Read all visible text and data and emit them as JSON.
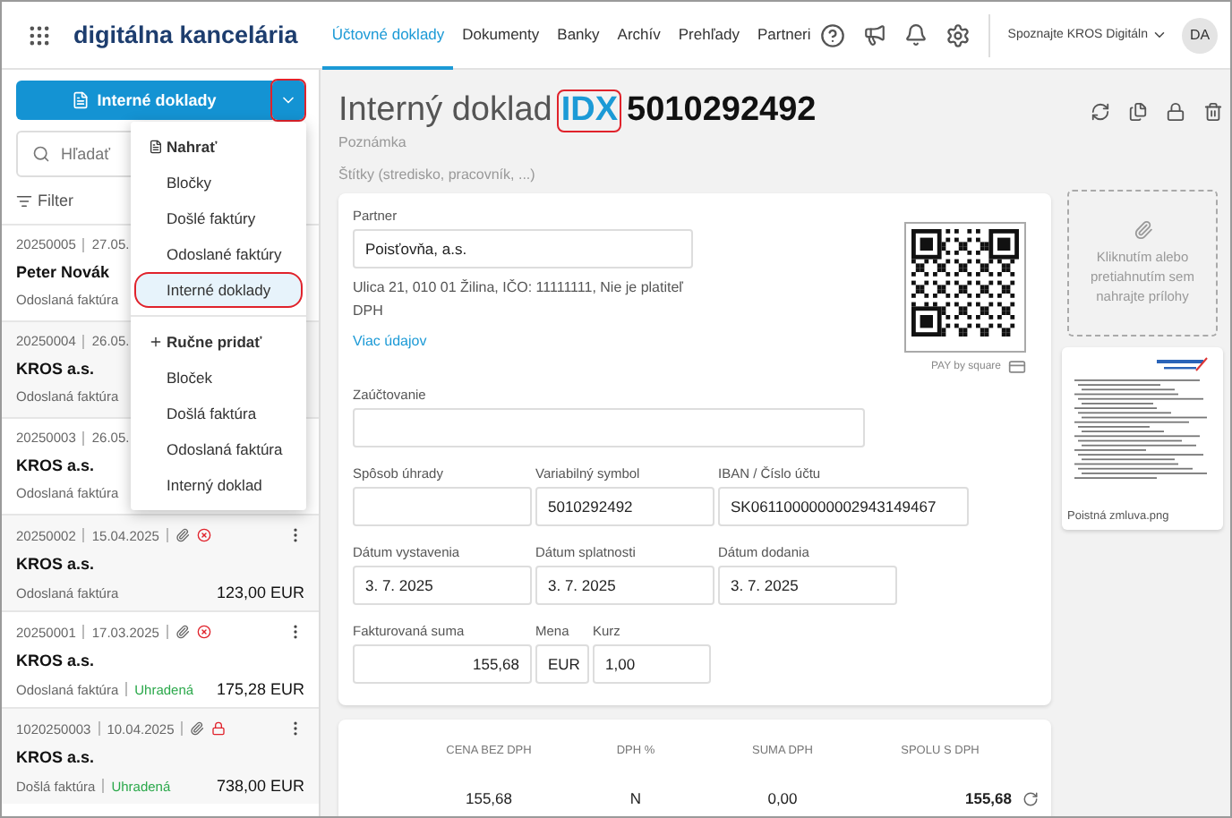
{
  "app": {
    "logo": "digitálna kancelária",
    "promo": "Spoznajte KROS Digitáln",
    "avatar": "DA"
  },
  "nav_tabs": [
    {
      "label": "Účtovné doklady",
      "selected": true
    },
    {
      "label": "Dokumenty",
      "selected": false
    },
    {
      "label": "Banky",
      "selected": false
    },
    {
      "label": "Archív",
      "selected": false
    },
    {
      "label": "Prehľady",
      "selected": false
    },
    {
      "label": "Partneri",
      "selected": false
    }
  ],
  "sidebar": {
    "create_button": {
      "label": "Interné doklady",
      "toggle_highlighted": true
    },
    "search": {
      "placeholder": "Hľadať"
    },
    "filter": {
      "label": "Filter"
    },
    "documents": [
      {
        "number": "20250005",
        "date": "27.05.",
        "partner": "Peter Novák",
        "type": "Odoslaná faktúra"
      },
      {
        "number": "20250004",
        "date": "26.05.",
        "partner": "KROS a.s.",
        "type": "Odoslaná faktúra"
      },
      {
        "number": "20250003",
        "date": "26.05.",
        "partner": "KROS a.s.",
        "type": "Odoslaná faktúra"
      },
      {
        "number": "20250002",
        "date": "15.04.2025",
        "attachment": true,
        "cancelled": true,
        "locked": false,
        "partner": "KROS a.s.",
        "type": "Odoslaná faktúra",
        "amount": "123,00 EUR"
      },
      {
        "number": "20250001",
        "date": "17.03.2025",
        "attachment": true,
        "cancelled": true,
        "locked": false,
        "partner": "KROS a.s.",
        "type": "Odoslaná faktúra",
        "payment_status": "Uhradená",
        "amount": "175,28 EUR"
      },
      {
        "number": "1020250003",
        "date": "10.04.2025",
        "attachment": true,
        "cancelled": false,
        "locked": true,
        "partner": "KROS a.s.",
        "type": "Došlá faktúra",
        "payment_status": "Uhradená",
        "amount": "738,00 EUR"
      }
    ]
  },
  "dropdown": {
    "expanded": true,
    "sections": [
      {
        "kind": "upload",
        "heading": "Nahrať",
        "items": [
          {
            "label": "Bločky",
            "selected": false,
            "highlighted": false
          },
          {
            "label": "Došlé faktúry",
            "selected": false,
            "highlighted": false
          },
          {
            "label": "Odoslané faktúry",
            "selected": false,
            "highlighted": false
          },
          {
            "label": "Interné doklady",
            "selected": true,
            "highlighted": true
          }
        ]
      },
      {
        "kind": "manual",
        "heading": "Ručne pridať",
        "items": [
          {
            "label": "Bloček",
            "selected": false,
            "highlighted": false
          },
          {
            "label": "Došlá faktúra",
            "selected": false,
            "highlighted": false
          },
          {
            "label": "Odoslaná faktúra",
            "selected": false,
            "highlighted": false
          },
          {
            "label": "Interný doklad",
            "selected": false,
            "highlighted": false
          }
        ]
      }
    ]
  },
  "document": {
    "title": "Interný doklad",
    "code": "IDX",
    "code_highlighted": true,
    "number": "5010292492",
    "note_placeholder": "Poznámka",
    "tags_placeholder": "Štítky (stredisko, pracovník, ...)"
  },
  "form": {
    "partner": {
      "label": "Partner",
      "value": "Poisťovňa, a.s.",
      "address": "Ulica 21, 010 01 Žilina, IČO: 11111111, Nie je platiteľ DPH",
      "more_link": "Viac údajov"
    },
    "pay_label": "PAY by square",
    "posting": {
      "label": "Zaúčtovanie"
    },
    "payment": [
      {
        "label": "Spôsob úhrady"
      },
      {
        "label": "Variabilný symbol",
        "value": "5010292492"
      },
      {
        "label": "IBAN / Číslo účtu",
        "value": "SK0611000000002943149467"
      }
    ],
    "dates": [
      {
        "label": "Dátum vystavenia",
        "value": "3. 7. 2025"
      },
      {
        "label": "Dátum splatnosti",
        "value": "3. 7. 2025"
      },
      {
        "label": "Dátum dodania",
        "value": "3. 7. 2025"
      }
    ],
    "amount": {
      "label": "Fakturovaná suma",
      "value": "155,68"
    },
    "currency": {
      "label": "Mena",
      "value": "EUR"
    },
    "rate": {
      "label": "Kurz",
      "value": "1,00"
    }
  },
  "vat_table": {
    "columns": [
      "CENA BEZ DPH",
      "DPH %",
      "SUMA DPH",
      "SPOLU S DPH"
    ],
    "rows": [
      [
        "155,68",
        "N",
        "0,00",
        "155,68"
      ]
    ]
  },
  "attachments": {
    "upload_hint": "Kliknutím alebo pretiahnutím sem nahrajte prílohy",
    "files": [
      {
        "name": "Poistná zmluva.png"
      }
    ]
  }
}
